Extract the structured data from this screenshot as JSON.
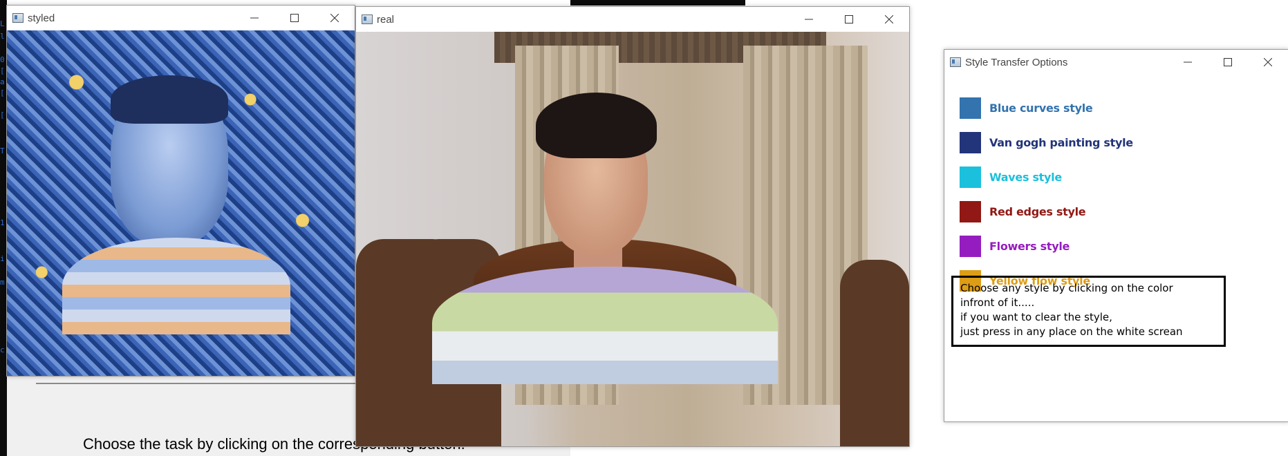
{
  "background": {
    "console_chars": [
      "L",
      "l",
      "0",
      "[",
      "a",
      "[",
      "[",
      "T",
      "1",
      "i",
      "m",
      "c"
    ],
    "task_prompt": "Choose the task by clicking on the corresponding button."
  },
  "styled_window": {
    "title": "styled",
    "image_description": "style-transferred webcam frame"
  },
  "real_window": {
    "title": "real",
    "image_description": "live webcam frame"
  },
  "options_window": {
    "title": "Style Transfer Options",
    "styles": [
      {
        "label": "Blue curves style",
        "color": "#3373ae"
      },
      {
        "label": "Van gogh painting style",
        "color": "#22347a"
      },
      {
        "label": "Waves style",
        "color": "#1bc0dc"
      },
      {
        "label": "Red edges style",
        "color": "#911814"
      },
      {
        "label": "Flowers style",
        "color": "#951dc0"
      },
      {
        "label": "Yellow flow style",
        "color": "#dd9d16"
      }
    ],
    "instructions": [
      "Choose any style by clicking on the color",
      "infront of it.....",
      "if you want to clear the style,",
      "just press in any place on the white screan"
    ]
  },
  "controls": {
    "minimize": "minimize",
    "maximize": "maximize",
    "close": "close"
  }
}
